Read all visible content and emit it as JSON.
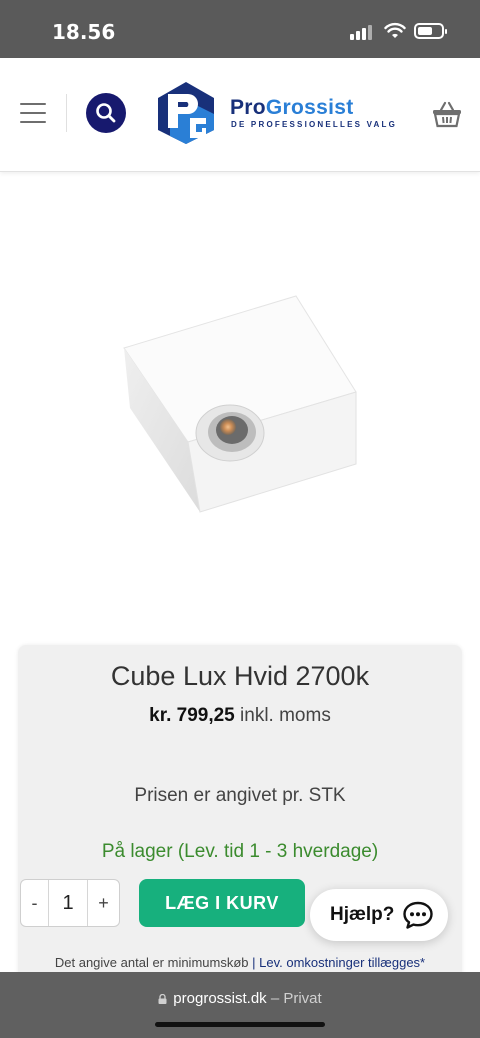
{
  "status_bar": {
    "time": "18.56"
  },
  "header": {
    "brand_name_part1": "Pro",
    "brand_name_part2": "Grossist",
    "brand_tagline": "DE PROFESSIONELLES VALG"
  },
  "product": {
    "title": "Cube Lux Hvid 2700k",
    "price": "kr. 799,25",
    "price_suffix": "inkl. moms",
    "unit_note": "Prisen er angivet pr. STK",
    "stock_status": "På lager (Lev. tid 1 - 3 hverdage)",
    "quantity": "1",
    "minus_label": "-",
    "plus_label": "+",
    "add_to_cart_label": "LÆG I KURV",
    "fine_print_text": "Det angive antal er minimumskøb",
    "fine_print_separator": "|",
    "fine_print_link": "Lev. omkostninger tillægges*"
  },
  "help": {
    "label": "Hjælp?"
  },
  "browser": {
    "url": "progrossist.dk",
    "mode": "– Privat"
  },
  "colors": {
    "brand_dark": "#18307a",
    "brand_light": "#2a7fd6",
    "search_bg": "#17196e",
    "add_button": "#17b07d",
    "stock_green": "#3b8b2e"
  },
  "icons": [
    "hamburger-menu-icon",
    "search-icon",
    "brand-logo",
    "cart-icon",
    "chat-icon",
    "lock-icon",
    "signal-icon",
    "wifi-icon",
    "battery-icon"
  ]
}
